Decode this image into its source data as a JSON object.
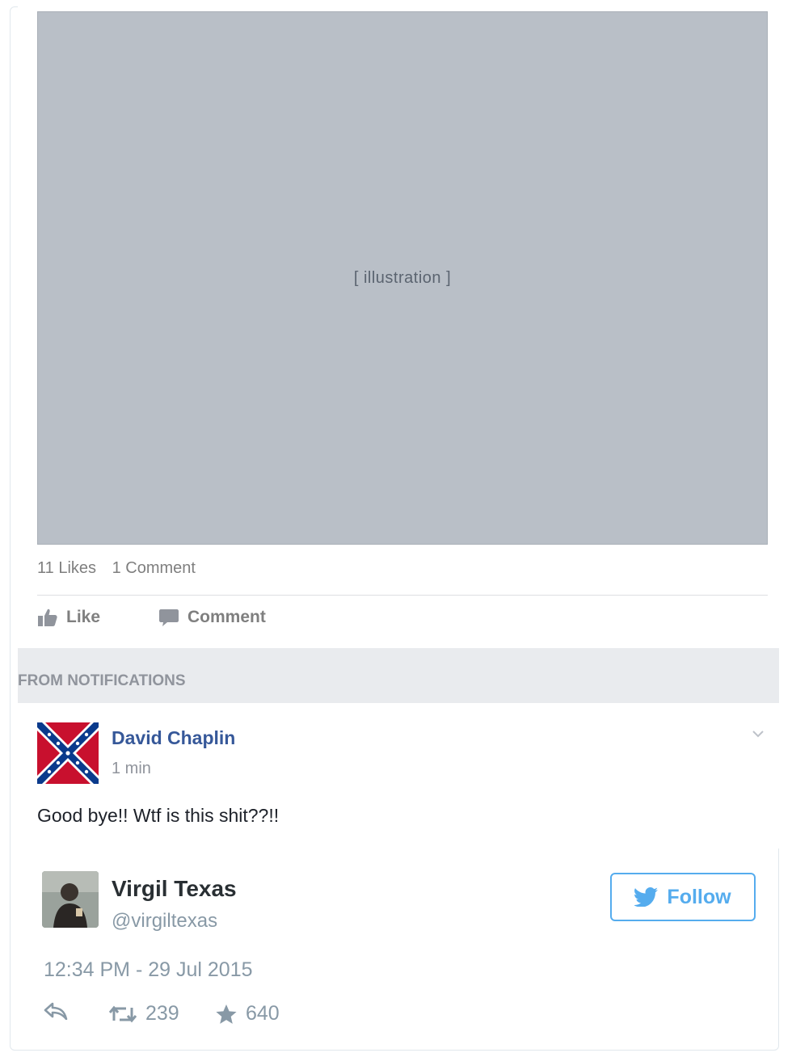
{
  "facebook_post": {
    "stats": {
      "likes": "11 Likes",
      "comments": "1 Comment"
    },
    "actions": {
      "like_label": "Like",
      "comment_label": "Comment"
    }
  },
  "notifications": {
    "section_label": "FROM NOTIFICATIONS",
    "comment": {
      "author": "David Chaplin",
      "time": "1 min",
      "text": "Good bye!! Wtf is this shit??!!"
    }
  },
  "tweet": {
    "author_name": "Virgil Texas",
    "handle": "@virgiltexas",
    "follow_label": "Follow",
    "timestamp": "12:34 PM - 29 Jul 2015",
    "retweets": "239",
    "favorites": "640"
  },
  "colors": {
    "twitter_blue": "#55acee",
    "facebook_link": "#365899",
    "muted_gray": "#90949c",
    "notif_band": "#e9ebee"
  },
  "icons": [
    "thumbs-up-icon",
    "comment-bubble-icon",
    "chevron-down-icon",
    "twitter-bird-icon",
    "reply-icon",
    "retweet-icon",
    "star-icon"
  ]
}
